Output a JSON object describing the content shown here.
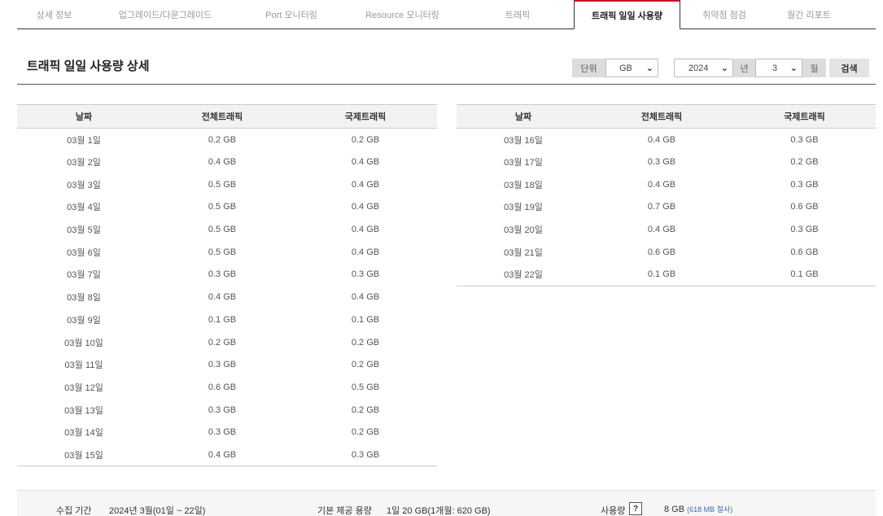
{
  "tabs": [
    {
      "label": "상세 정보"
    },
    {
      "label": "업그레이드/다운그레이드"
    },
    {
      "label": "Port 모니터링"
    },
    {
      "label": "Resource 모니터링"
    },
    {
      "label": "트래픽"
    },
    {
      "label": "트래픽 일일 사용량",
      "active": true
    },
    {
      "label": "취약점 점검"
    },
    {
      "label": "월간 리포트"
    }
  ],
  "page_title": "트래픽 일일 사용량 상세",
  "controls": {
    "unit_label": "단위",
    "unit_value": "GB",
    "year_value": "2024",
    "year_suffix": "년",
    "month_value": "3",
    "month_suffix": "월",
    "search_label": "검색"
  },
  "table_headers": [
    "날짜",
    "전체트래픽",
    "국제트래픽"
  ],
  "rows_left": [
    [
      "03월 1일",
      "0.2 GB",
      "0.2 GB"
    ],
    [
      "03월 2일",
      "0.4 GB",
      "0.4 GB"
    ],
    [
      "03월 3일",
      "0.5 GB",
      "0.4 GB"
    ],
    [
      "03월 4일",
      "0.5 GB",
      "0.4 GB"
    ],
    [
      "03월 5일",
      "0.5 GB",
      "0.4 GB"
    ],
    [
      "03월 6일",
      "0.5 GB",
      "0.4 GB"
    ],
    [
      "03월 7일",
      "0.3 GB",
      "0.3 GB"
    ],
    [
      "03월 8일",
      "0.4 GB",
      "0.4 GB"
    ],
    [
      "03월 9일",
      "0.1 GB",
      "0.1 GB"
    ],
    [
      "03월 10일",
      "0.2 GB",
      "0.2 GB"
    ],
    [
      "03월 11일",
      "0.3 GB",
      "0.2 GB"
    ],
    [
      "03월 12일",
      "0.6 GB",
      "0.5 GB"
    ],
    [
      "03월 13일",
      "0.3 GB",
      "0.2 GB"
    ],
    [
      "03월 14일",
      "0.3 GB",
      "0.2 GB"
    ],
    [
      "03월 15일",
      "0.4 GB",
      "0.3 GB"
    ]
  ],
  "rows_right": [
    [
      "03월 16일",
      "0.4 GB",
      "0.3 GB"
    ],
    [
      "03월 17일",
      "0.3 GB",
      "0.2 GB"
    ],
    [
      "03월 18일",
      "0.4 GB",
      "0.3 GB"
    ],
    [
      "03월 19일",
      "0.7 GB",
      "0.6 GB"
    ],
    [
      "03월 20일",
      "0.4 GB",
      "0.3 GB"
    ],
    [
      "03월 21일",
      "0.6 GB",
      "0.6 GB"
    ],
    [
      "03월 22일",
      "0.1 GB",
      "0.1 GB"
    ]
  ],
  "summary": {
    "period_label": "수집 기간",
    "period_value": "2024년 3월(01일 ~ 22일)",
    "quota_label": "기본 제공 용량",
    "quota_value": "1일 20 GB(1개월: 620 GB)",
    "usage_label": "사용량",
    "help_icon": "?",
    "usage_value": "8 GB",
    "usage_note": "(618 MB 절사)"
  }
}
